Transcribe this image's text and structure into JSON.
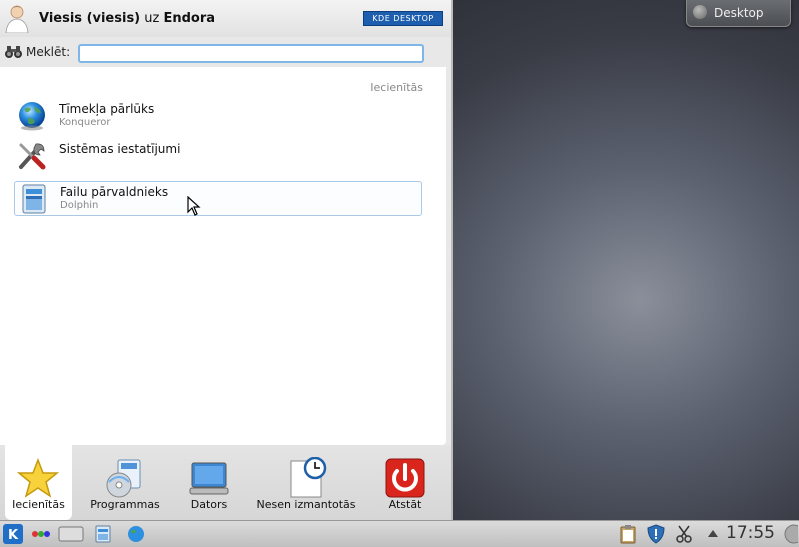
{
  "desktop": {
    "button_label": "Desktop"
  },
  "header": {
    "user_display": "Viesis (viesis)",
    "connector": "uz",
    "host": "Endora",
    "logo_text": "KDE DESKTOP"
  },
  "search": {
    "label": "Meklēt:",
    "value": "",
    "placeholder": ""
  },
  "favorites": {
    "section_label": "Iecienītās",
    "items": [
      {
        "name": "Tīmekļa pārlūks",
        "sub": "Konqueror",
        "icon": "globe-icon"
      },
      {
        "name": "Sistēmas iestatījumi",
        "sub": "",
        "icon": "tools-icon"
      },
      {
        "name": "Failu pārvaldnieks",
        "sub": "Dolphin",
        "icon": "file-manager-icon"
      }
    ]
  },
  "tabs": [
    {
      "label": "Iecienītās",
      "icon": "star-icon",
      "active": true
    },
    {
      "label": "Programmas",
      "icon": "applications-icon"
    },
    {
      "label": "Dators",
      "icon": "computer-icon"
    },
    {
      "label": "Nesen izmantotās",
      "icon": "recent-clock-icon"
    },
    {
      "label": "Atstāt",
      "icon": "power-icon"
    }
  ],
  "taskbar": {
    "clock": "17:55"
  }
}
